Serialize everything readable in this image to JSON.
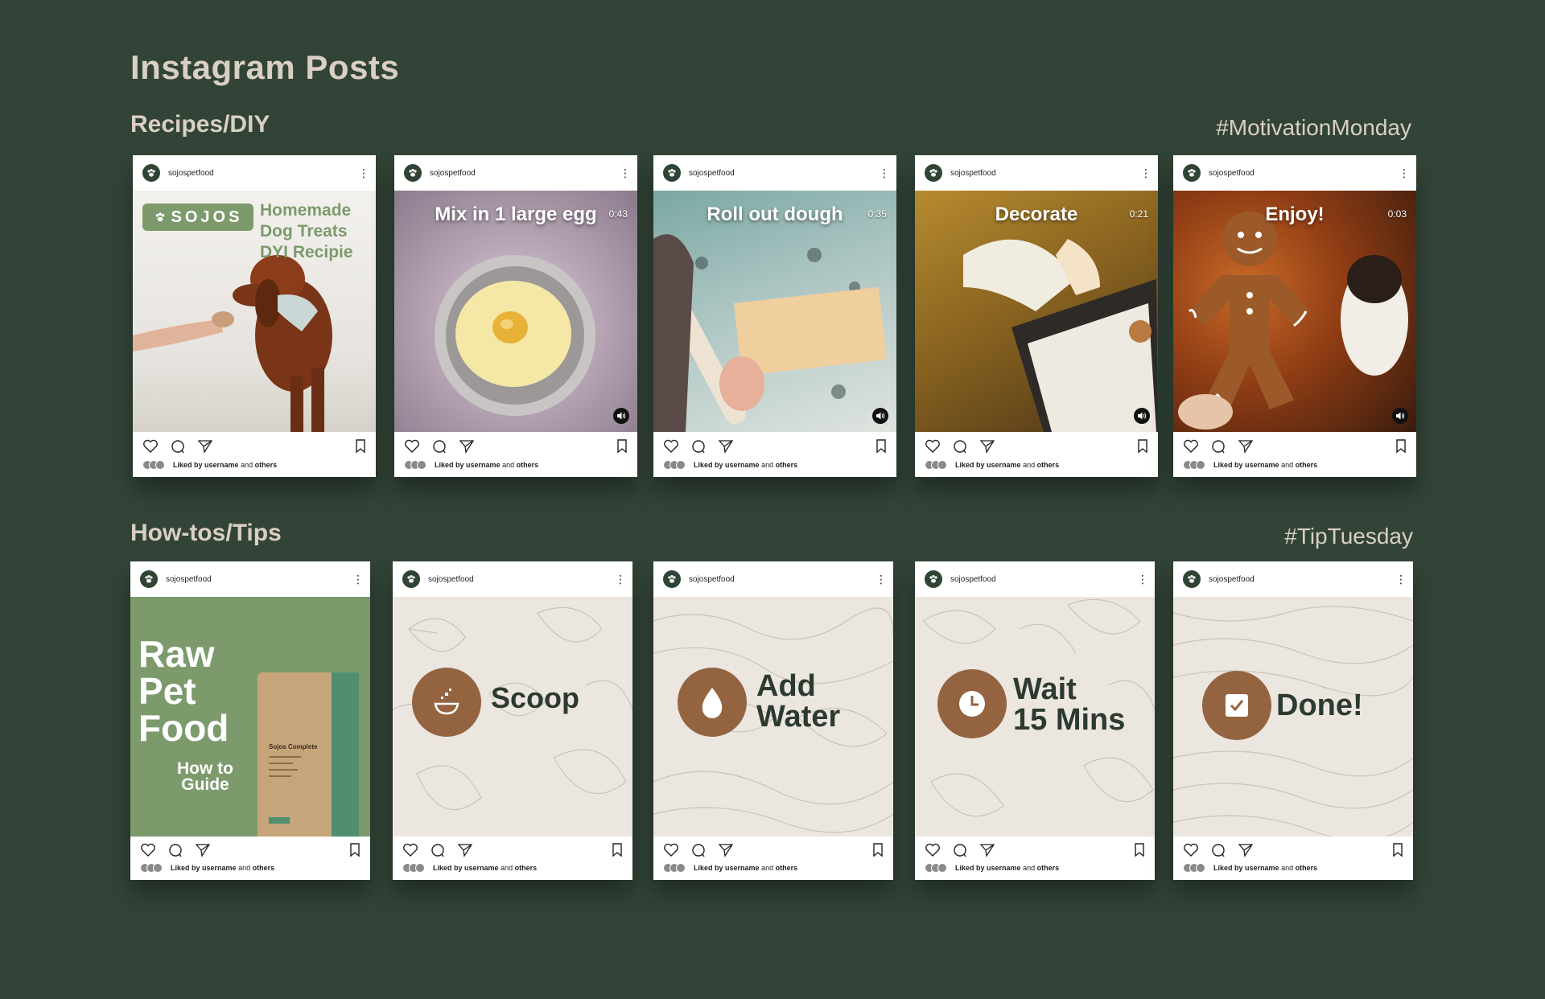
{
  "page": {
    "title": "Instagram Posts"
  },
  "rows": [
    {
      "section": "Recipes/DIY",
      "hashtag": "#MotivationMonday"
    },
    {
      "section": "How-tos/Tips",
      "hashtag": "#TipTuesday"
    }
  ],
  "post_common": {
    "username": "sojospetfood",
    "liked_prefix": "Liked by",
    "liked_user": "username",
    "liked_and": "and",
    "liked_others": "others"
  },
  "recipe_cover": {
    "brand": "SOJOS",
    "headline_1": "Homemade",
    "headline_2": "Dog Treats",
    "headline_3": "DYI Recipie"
  },
  "videos": [
    {
      "caption": "Mix in 1 large egg",
      "duration": "0:43"
    },
    {
      "caption": "Roll out dough",
      "duration": "0:35"
    },
    {
      "caption": "Decorate",
      "duration": "0:21"
    },
    {
      "caption": "Enjoy!",
      "duration": "0:03"
    }
  ],
  "guide_cover": {
    "line_1": "Raw",
    "line_2": "Pet",
    "line_3": "Food",
    "sub_1": "How to",
    "sub_2": "Guide",
    "bag_title": "Sojos Complete"
  },
  "tips": [
    {
      "line_1": "Scoop",
      "line_2": "",
      "icon": "scoop-bowl-icon"
    },
    {
      "line_1": "Add",
      "line_2": "Water",
      "icon": "water-drop-icon"
    },
    {
      "line_1": "Wait",
      "line_2": "15 Mins",
      "icon": "clock-icon"
    },
    {
      "line_1": "Done!",
      "line_2": "",
      "icon": "checkbox-icon"
    }
  ],
  "colors": {
    "background": "#324437",
    "heading": "#d9cfc3",
    "sage": "#7c9a6c",
    "brown": "#946440",
    "tip_bg": "#ece6e1",
    "dark_text": "#2d3a2f"
  }
}
